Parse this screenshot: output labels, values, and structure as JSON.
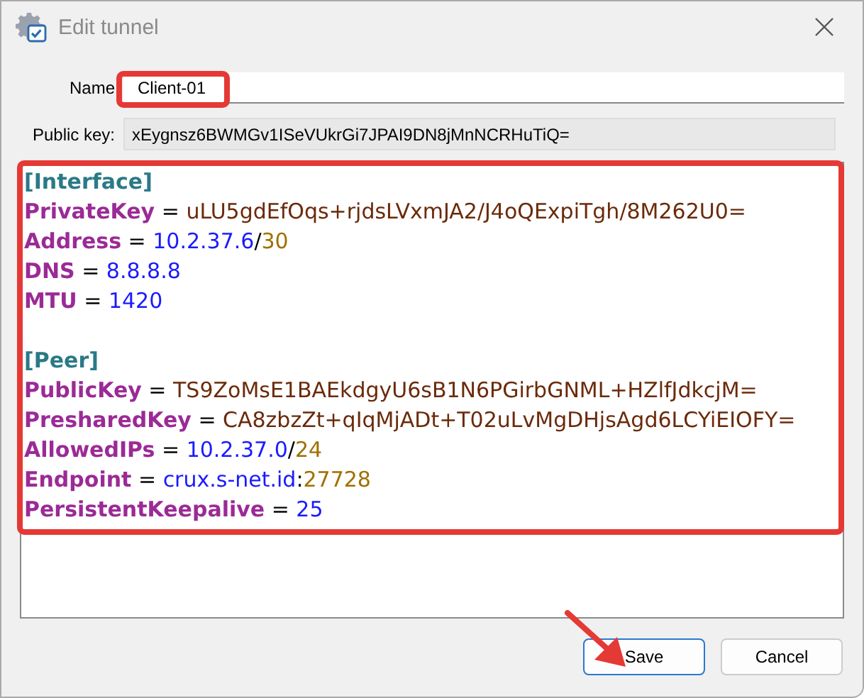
{
  "window": {
    "title": "Edit tunnel"
  },
  "fields": [
    {
      "kind": "input",
      "label": "Name",
      "value": "Client-01",
      "highlighted": true
    },
    {
      "kind": "readonly",
      "label": "Public key:",
      "value": "xEygnsz6BWMGv1ISeVUkrGi7JPAI9DN8jMnNCRHuTiQ=",
      "highlighted": false
    }
  ],
  "editor": {
    "highlighted": true,
    "lines": [
      {
        "kind": "section",
        "text": "[Interface]"
      },
      {
        "kind": "pair",
        "key": "PrivateKey",
        "tokens": [
          {
            "kind": "plain",
            "text": " = "
          },
          {
            "kind": "key",
            "text": "uLU5gdEfOqs+rjdsLVxmJA2/J4oQExpiTgh/8M262U0="
          }
        ]
      },
      {
        "kind": "pair",
        "key": "Address",
        "tokens": [
          {
            "kind": "plain",
            "text": " = "
          },
          {
            "kind": "ip",
            "text": "10.2.37.6"
          },
          {
            "kind": "plain",
            "text": "/"
          },
          {
            "kind": "number",
            "text": "30"
          }
        ]
      },
      {
        "kind": "pair",
        "key": "DNS",
        "tokens": [
          {
            "kind": "plain",
            "text": " = "
          },
          {
            "kind": "ip",
            "text": "8.8.8.8"
          }
        ]
      },
      {
        "kind": "pair",
        "key": "MTU",
        "tokens": [
          {
            "kind": "plain",
            "text": " = "
          },
          {
            "kind": "ip",
            "text": "1420"
          }
        ]
      },
      {
        "kind": "blank"
      },
      {
        "kind": "section",
        "text": "[Peer]"
      },
      {
        "kind": "pair",
        "key": "PublicKey",
        "tokens": [
          {
            "kind": "plain",
            "text": " = "
          },
          {
            "kind": "key",
            "text": "TS9ZoMsE1BAEkdgyU6sB1N6PGirbGNML+HZlfJdkcjM="
          }
        ]
      },
      {
        "kind": "pair",
        "key": "PresharedKey",
        "tokens": [
          {
            "kind": "plain",
            "text": " = "
          },
          {
            "kind": "key",
            "text": "CA8zbzZt+qIqMjADt+T02uLvMgDHjsAgd6LCYiEIOFY="
          }
        ]
      },
      {
        "kind": "pair",
        "key": "AllowedIPs",
        "tokens": [
          {
            "kind": "plain",
            "text": " = "
          },
          {
            "kind": "ip",
            "text": "10.2.37.0"
          },
          {
            "kind": "plain",
            "text": "/"
          },
          {
            "kind": "number",
            "text": "24"
          }
        ]
      },
      {
        "kind": "pair",
        "key": "Endpoint",
        "tokens": [
          {
            "kind": "plain",
            "text": " = "
          },
          {
            "kind": "host",
            "text": "crux.s-net.id"
          },
          {
            "kind": "plain",
            "text": ":"
          },
          {
            "kind": "number",
            "text": "27728"
          }
        ]
      },
      {
        "kind": "pair",
        "key": "PersistentKeepalive",
        "tokens": [
          {
            "kind": "plain",
            "text": " = "
          },
          {
            "kind": "host",
            "text": "25"
          }
        ]
      }
    ]
  },
  "buttons": [
    {
      "label": "Save",
      "default": true,
      "arrow_pointer": true
    },
    {
      "label": "Cancel",
      "default": false,
      "arrow_pointer": false
    }
  ]
}
